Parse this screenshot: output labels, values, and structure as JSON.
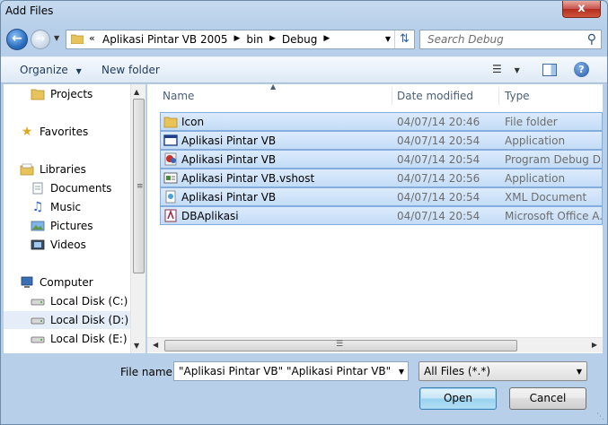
{
  "window": {
    "title": "Add Files",
    "close_label": "x"
  },
  "nav": {
    "back_icon": "back-arrow-icon",
    "forward_icon": "forward-arrow-icon",
    "address_prefix": "«",
    "breadcrumbs": [
      "Aplikasi Pintar VB 2005",
      "bin",
      "Debug"
    ],
    "search_placeholder": "Search Debug"
  },
  "toolbar": {
    "organize_label": "Organize",
    "new_folder_label": "New folder"
  },
  "sidebar": {
    "items": [
      {
        "label": "Projects",
        "icon": "folder-icon"
      },
      {
        "label": "Favorites",
        "icon": "star-icon"
      },
      {
        "label": "Libraries",
        "icon": "libraries-icon"
      },
      {
        "label": "Documents",
        "icon": "documents-icon"
      },
      {
        "label": "Music",
        "icon": "music-icon"
      },
      {
        "label": "Pictures",
        "icon": "pictures-icon"
      },
      {
        "label": "Videos",
        "icon": "videos-icon"
      },
      {
        "label": "Computer",
        "icon": "computer-icon"
      },
      {
        "label": "Local Disk (C:)",
        "icon": "disk-icon"
      },
      {
        "label": "Local Disk (D:)",
        "icon": "disk-icon",
        "selected": true
      },
      {
        "label": "Local Disk (E:)",
        "icon": "disk-icon"
      }
    ]
  },
  "files": {
    "columns": [
      "Name",
      "Date modified",
      "Type"
    ],
    "rows": [
      {
        "name": "Icon",
        "date": "04/07/14 20:46",
        "type": "File folder",
        "icon": "folder-icon"
      },
      {
        "name": "Aplikasi Pintar VB",
        "date": "04/07/14 20:54",
        "type": "Application",
        "icon": "application-icon"
      },
      {
        "name": "Aplikasi Pintar VB",
        "date": "04/07/14 20:54",
        "type": "Program Debug D...",
        "icon": "debug-database-icon"
      },
      {
        "name": "Aplikasi Pintar VB.vshost",
        "date": "04/07/14 20:56",
        "type": "Application",
        "icon": "vshost-icon"
      },
      {
        "name": "Aplikasi Pintar VB",
        "date": "04/07/14 20:54",
        "type": "XML Document",
        "icon": "xml-document-icon"
      },
      {
        "name": "DBAplikasi",
        "date": "04/07/14 20:54",
        "type": "Microsoft Office A...",
        "icon": "access-database-icon"
      }
    ]
  },
  "footer": {
    "file_name_label": "File name:",
    "file_name_value": "\"Aplikasi Pintar VB\" \"Aplikasi Pintar VB\" \"Apli",
    "file_type_value": "All Files (*.*)",
    "open_label": "Open",
    "cancel_label": "Cancel"
  }
}
